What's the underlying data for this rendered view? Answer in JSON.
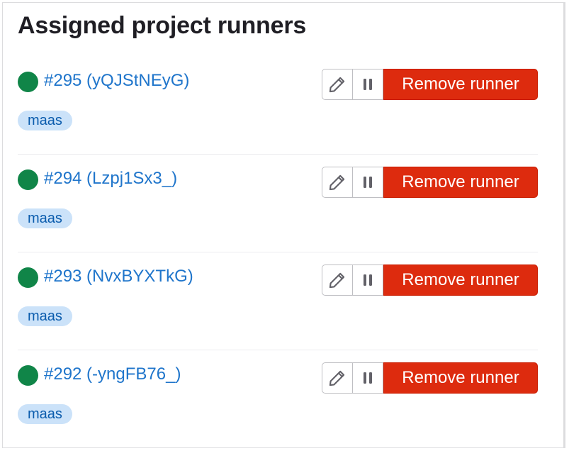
{
  "panel": {
    "title": "Assigned project runners"
  },
  "runners": [
    {
      "label": "#295 (yQJStNEyG)",
      "tag": "maas",
      "remove_label": "Remove runner",
      "status": "online"
    },
    {
      "label": "#294 (Lzpj1Sx3_)",
      "tag": "maas",
      "remove_label": "Remove runner",
      "status": "online"
    },
    {
      "label": "#293 (NvxBYXTkG)",
      "tag": "maas",
      "remove_label": "Remove runner",
      "status": "online"
    },
    {
      "label": "#292 (-yngFB76_)",
      "tag": "maas",
      "remove_label": "Remove runner",
      "status": "online"
    }
  ],
  "icons": {
    "edit": "pencil-icon",
    "pause": "pause-icon",
    "status": "status-dot-icon"
  },
  "colors": {
    "status_online": "#108548",
    "link": "#1f75cb",
    "badge_bg": "#cbe2f9",
    "badge_text": "#0b5cad",
    "danger": "#dd2b0e",
    "heading": "#1f1e24"
  }
}
